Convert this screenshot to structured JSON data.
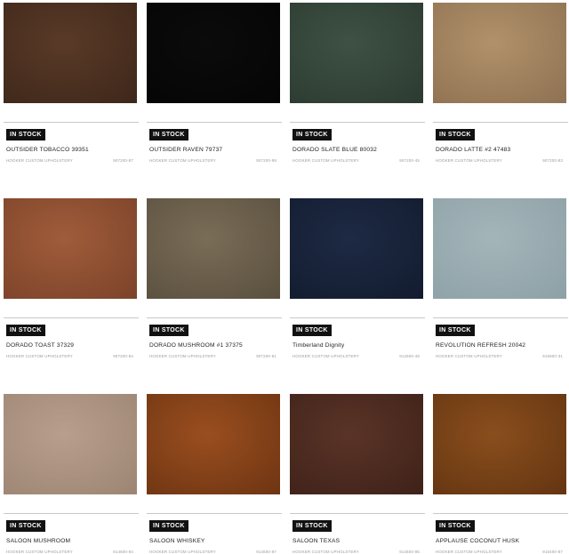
{
  "products": [
    {
      "badge": "IN STOCK",
      "name": "OUTSIDER TOBACCO 39351",
      "brand": "HOOKER CUSTOM UPHOLSTERY",
      "sku": "907200-87",
      "color": "#5a3a27",
      "color2": "#3e271a"
    },
    {
      "badge": "IN STOCK",
      "name": "OUTSIDER RAVEN 79737",
      "brand": "HOOKER CUSTOM UPHOLSTERY",
      "sku": "907200-99",
      "color": "#0b0b0c",
      "color2": "#050505"
    },
    {
      "badge": "IN STOCK",
      "name": "DORADO SLATE BLUE 80032",
      "brand": "HOOKER CUSTOM UPHOLSTERY",
      "sku": "907200-45",
      "color": "#3e5144",
      "color2": "#2c3b31"
    },
    {
      "badge": "IN STOCK",
      "name": "DORADO LATTE #2 47483",
      "brand": "HOOKER CUSTOM UPHOLSTERY",
      "sku": "907200-83",
      "color": "#b1916a",
      "color2": "#8f7253"
    },
    {
      "badge": "IN STOCK",
      "name": "DORADO TOAST 37329",
      "brand": "HOOKER CUSTOM UPHOLSTERY",
      "sku": "907200-84",
      "color": "#a05c3a",
      "color2": "#7c432a"
    },
    {
      "badge": "IN STOCK",
      "name": "DORADO MUSHROOM #1 37375",
      "brand": "HOOKER CUSTOM UPHOLSTERY",
      "sku": "907200-81",
      "color": "#7a6d57",
      "color2": "#5a503f"
    },
    {
      "badge": "IN STOCK",
      "name": "Timberland Dignity",
      "brand": "HOOKER CUSTOM UPHOLSTERY",
      "sku": "912500-48",
      "color": "#1d2a44",
      "color2": "#131c2f"
    },
    {
      "badge": "IN STOCK",
      "name": "REVOLUTION REFRESH 20042",
      "brand": "HOOKER CUSTOM UPHOLSTERY",
      "sku": "915800-31",
      "color": "#a3b5b9",
      "color2": "#8ea1a6"
    },
    {
      "badge": "IN STOCK",
      "name": "SALOON MUSHROOM",
      "brand": "HOOKER CUSTOM UPHOLSTERY",
      "sku": "914600-84",
      "color": "#b89f8d",
      "color2": "#9d8574"
    },
    {
      "badge": "IN STOCK",
      "name": "SALOON WHISKEY",
      "brand": "HOOKER CUSTOM UPHOLSTERY",
      "sku": "914600-87",
      "color": "#9a4e1f",
      "color2": "#6e3512"
    },
    {
      "badge": "IN STOCK",
      "name": "SALOON TEXAS",
      "brand": "HOOKER CUSTOM UPHOLSTERY",
      "sku": "914600-85",
      "color": "#5a3327",
      "color2": "#3f2219"
    },
    {
      "badge": "IN STOCK",
      "name": "APPLAUSE COCONUT HUSK",
      "brand": "HOOKER CUSTOM UPHOLSTERY",
      "sku": "915400-87",
      "color": "#8a4e1d",
      "color2": "#643511"
    }
  ]
}
